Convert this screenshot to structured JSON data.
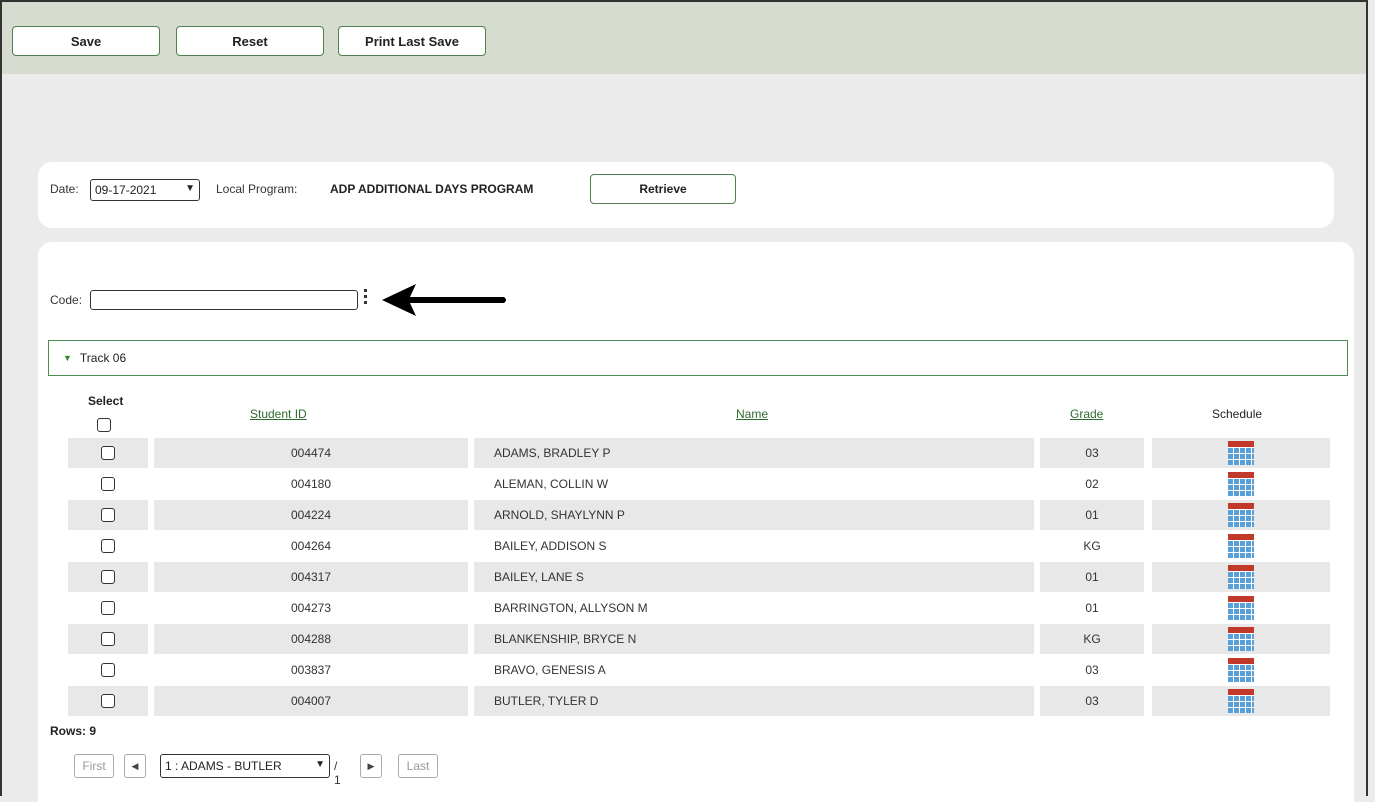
{
  "toolbar": {
    "save_label": "Save",
    "reset_label": "Reset",
    "print_label": "Print Last Save"
  },
  "filters": {
    "date_label": "Date:",
    "date_value": "09-17-2021",
    "local_program_label": "Local Program:",
    "local_program_value": "ADP ADDITIONAL DAYS PROGRAM",
    "retrieve_label": "Retrieve"
  },
  "code": {
    "label": "Code:",
    "value": ""
  },
  "track": {
    "label": "Track 06"
  },
  "table": {
    "headers": {
      "select": "Select",
      "student_id": "Student ID",
      "name": "Name",
      "grade": "Grade",
      "schedule": "Schedule"
    },
    "rows": [
      {
        "student_id": "004474",
        "name": "ADAMS, BRADLEY P",
        "grade": "03"
      },
      {
        "student_id": "004180",
        "name": "ALEMAN, COLLIN W",
        "grade": "02"
      },
      {
        "student_id": "004224",
        "name": "ARNOLD, SHAYLYNN P",
        "grade": "01"
      },
      {
        "student_id": "004264",
        "name": "BAILEY, ADDISON S",
        "grade": "KG"
      },
      {
        "student_id": "004317",
        "name": "BAILEY, LANE S",
        "grade": "01"
      },
      {
        "student_id": "004273",
        "name": "BARRINGTON, ALLYSON M",
        "grade": "01"
      },
      {
        "student_id": "004288",
        "name": "BLANKENSHIP, BRYCE N",
        "grade": "KG"
      },
      {
        "student_id": "003837",
        "name": "BRAVO, GENESIS A",
        "grade": "03"
      },
      {
        "student_id": "004007",
        "name": "BUTLER, TYLER D",
        "grade": "03"
      }
    ],
    "rows_label": "Rows: 9"
  },
  "pager": {
    "first_label": "First",
    "prev_label": "◀",
    "page_select": "1 : ADAMS - BUTLER",
    "total": "/ 1",
    "next_label": "▶",
    "last_label": "Last"
  },
  "icons": {
    "schedule": "calendar-icon",
    "more": "kebab-menu-icon",
    "annotation": "left-arrow-icon"
  },
  "colors": {
    "toolbar_bg": "#d7dcd0",
    "accent_green": "#4f7f4f",
    "link_green": "#2f6b2f"
  }
}
